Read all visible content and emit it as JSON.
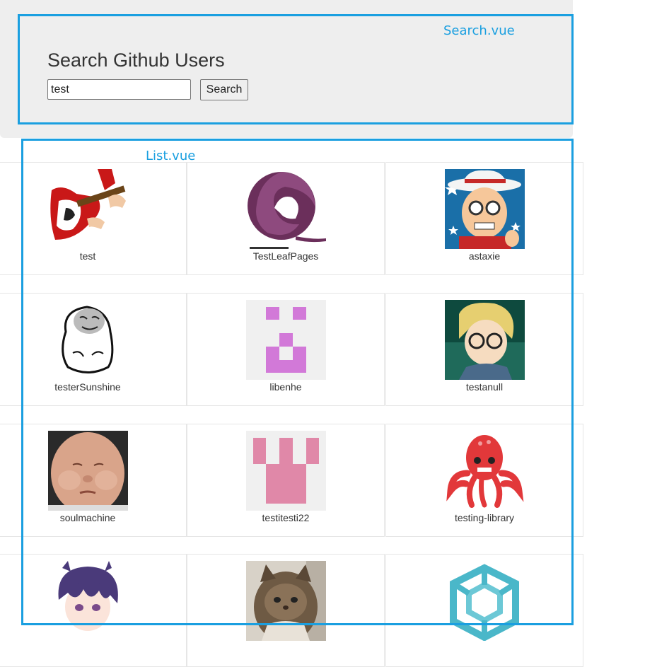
{
  "annotations": {
    "search_component": "Search.vue",
    "list_component": "List.vue"
  },
  "header": {
    "title": "Search Github Users"
  },
  "search": {
    "value": "test",
    "button_label": "Search"
  },
  "users": [
    {
      "login": "test",
      "avatar": "guitar-avatar"
    },
    {
      "login": "TestLeafPages",
      "avatar": "purple-swirl-logo"
    },
    {
      "login": "astaxie",
      "avatar": "cartoon-hat-avatar"
    },
    {
      "login": "testerSunshine",
      "avatar": "meme-face-avatar"
    },
    {
      "login": "libenhe",
      "avatar": "pixel-identicon-purple"
    },
    {
      "login": "testanull",
      "avatar": "anime-glasses-avatar"
    },
    {
      "login": "soulmachine",
      "avatar": "baby-face-avatar"
    },
    {
      "login": "testitesti22",
      "avatar": "pixel-identicon-pink"
    },
    {
      "login": "testing-library",
      "avatar": "red-octopus-logo"
    },
    {
      "login": "",
      "avatar": "anime-purple-hair-avatar"
    },
    {
      "login": "",
      "avatar": "cat-photo-avatar"
    },
    {
      "login": "",
      "avatar": "teal-cube-logo"
    }
  ],
  "colors": {
    "annotation_border": "#1a9fe0",
    "jumbotron_bg": "#eeeeee"
  }
}
